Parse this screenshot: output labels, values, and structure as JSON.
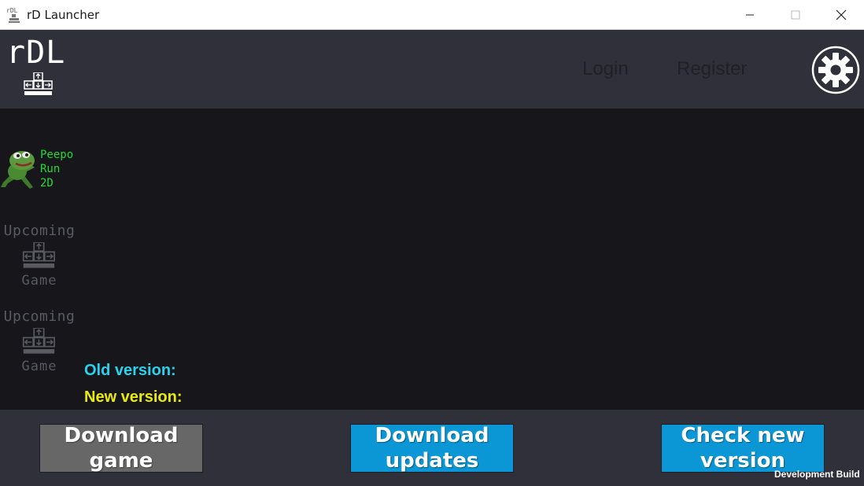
{
  "window": {
    "title": "rD Launcher",
    "app_icon_text": "rDL"
  },
  "header": {
    "logo_text": "rDL",
    "login_label": "Login",
    "register_label": "Register",
    "settings_icon": "gear-icon"
  },
  "sidebar": {
    "games": [
      {
        "name": "Peepo Run 2D",
        "icon": "frog-runner-icon",
        "color": "#22d936"
      }
    ],
    "upcoming": [
      {
        "top_label": "Upcoming",
        "bottom_label": "Game",
        "icon": "arrow-keys-icon"
      },
      {
        "top_label": "Upcoming",
        "bottom_label": "Game",
        "icon": "arrow-keys-icon"
      }
    ]
  },
  "versions": {
    "old_label": "Old version:",
    "new_label": "New version:",
    "old_color": "#29d3ee",
    "new_color": "#eaea10"
  },
  "footer": {
    "download_game_label": "Download game",
    "download_updates_label": "Download updates",
    "check_version_label": "Check new version",
    "dev_build_label": "Development Build"
  },
  "colors": {
    "header_bg": "#30303b",
    "content_bg": "#16161b",
    "accent_button": "#0b97d6",
    "disabled_button": "#676767"
  }
}
